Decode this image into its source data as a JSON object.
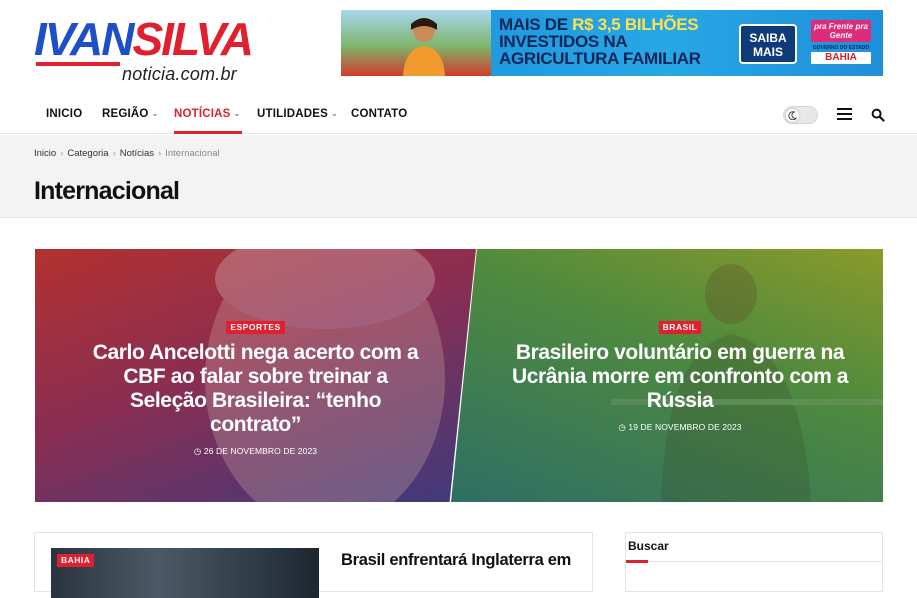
{
  "logo": {
    "part1": "IVAN",
    "part2": "SILVA",
    "subtitle": "noticia.com.br"
  },
  "banner": {
    "line1a": "MAIS DE ",
    "line1b": "R$ 3,5 BILHÕES",
    "line2": "INVESTIDOS NA",
    "line3": "AGRICULTURA FAMILIAR",
    "button": "SAIBA MAIS",
    "brand_line": "pra Frente pra Gente",
    "gov_line": "GOVERNO DO ESTADO",
    "state": "BAHIA"
  },
  "nav": {
    "items": [
      {
        "label": "INICIO",
        "has_dropdown": false
      },
      {
        "label": "REGIÃO",
        "has_dropdown": true
      },
      {
        "label": "NOTÍCIAS",
        "has_dropdown": true,
        "active": true
      },
      {
        "label": "UTILIDADES",
        "has_dropdown": true
      },
      {
        "label": "CONTATO",
        "has_dropdown": false
      }
    ],
    "icons": [
      "moon-icon",
      "hamburger-icon",
      "search-icon"
    ]
  },
  "breadcrumb": [
    "Inicio",
    "Categoria",
    "Notícias",
    "Internacional"
  ],
  "page_title": "Internacional",
  "hero": [
    {
      "tag": "ESPORTES",
      "title": "Carlo Ancelotti nega acerto com a CBF ao falar sobre treinar a Seleção Brasileira: “tenho contrato”",
      "date": "26 DE NOVEMBRO DE 2023"
    },
    {
      "tag": "BRASIL",
      "title": "Brasileiro voluntário em guerra na Ucrânia morre em confronto com a Rússia",
      "date": "19 DE NOVEMBRO DE 2023"
    }
  ],
  "article": {
    "tag": "BAHIA",
    "title": "Brasil enfrentará Inglaterra em"
  },
  "sidebar": {
    "title": "Buscar"
  },
  "colors": {
    "accent": "#e0202e",
    "logo_blue": "#1e4fc8"
  }
}
